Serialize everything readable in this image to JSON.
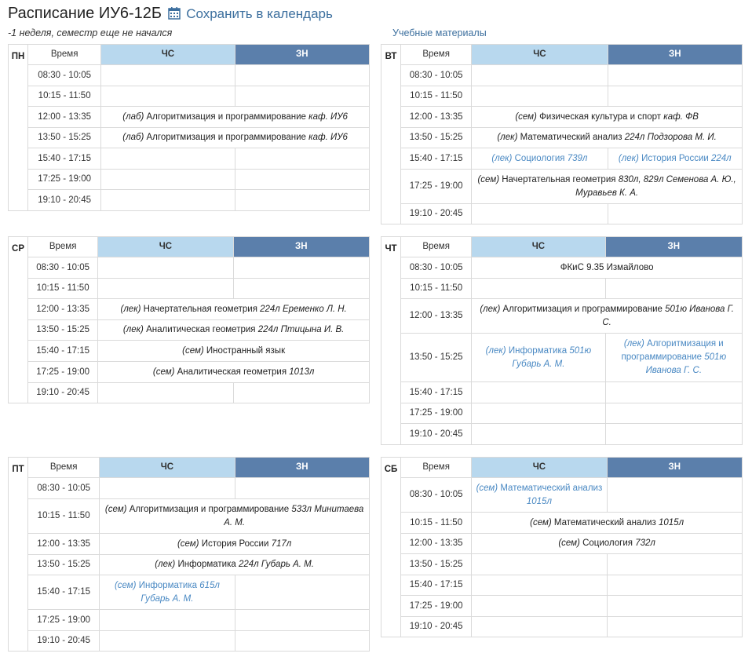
{
  "header": {
    "title": "Расписание ИУ6-12Б",
    "calendar_link": "Сохранить в календарь",
    "subtitle": "-1 неделя, семестр еще не начался",
    "materials_link": "Учебные материалы"
  },
  "colors": {
    "cs_header": "#b8d8ee",
    "zn_header": "#5b7fab",
    "link": "#3c6f9e",
    "alt_week_text": "#4a89c3"
  },
  "labels": {
    "time": "Время",
    "cs": "ЧС",
    "zn": "ЗН"
  },
  "days": [
    {
      "name": "ПН",
      "rows": [
        {
          "time": "08:30 - 10:05"
        },
        {
          "time": "10:15 - 11:50"
        },
        {
          "time": "12:00 - 13:35",
          "both": {
            "type": "(лаб)",
            "subject": "Алгоритмизация и программирование",
            "details": "каф. ИУ6"
          }
        },
        {
          "time": "13:50 - 15:25",
          "both": {
            "type": "(лаб)",
            "subject": "Алгоритмизация и программирование",
            "details": "каф. ИУ6"
          }
        },
        {
          "time": "15:40 - 17:15"
        },
        {
          "time": "17:25 - 19:00"
        },
        {
          "time": "19:10 - 20:45"
        }
      ]
    },
    {
      "name": "ВТ",
      "rows": [
        {
          "time": "08:30 - 10:05"
        },
        {
          "time": "10:15 - 11:50"
        },
        {
          "time": "12:00 - 13:35",
          "both": {
            "type": "(сем)",
            "subject": "Физическая культура и спорт",
            "details": "каф. ФВ"
          }
        },
        {
          "time": "13:50 - 15:25",
          "both": {
            "type": "(лек)",
            "subject": "Математический анализ",
            "details": "224л Подзорова М. И."
          }
        },
        {
          "time": "15:40 - 17:15",
          "cs": {
            "type": "(лек)",
            "subject": "Социология",
            "details": "739л"
          },
          "zn": {
            "type": "(лек)",
            "subject": "История России",
            "details": "224л"
          }
        },
        {
          "time": "17:25 - 19:00",
          "both": {
            "type": "(сем)",
            "subject": "Начертательная геометрия",
            "details": "830л, 829л Семенова А. Ю., Муравьев К. А."
          }
        },
        {
          "time": "19:10 - 20:45"
        }
      ]
    },
    {
      "name": "СР",
      "rows": [
        {
          "time": "08:30 - 10:05"
        },
        {
          "time": "10:15 - 11:50"
        },
        {
          "time": "12:00 - 13:35",
          "both": {
            "type": "(лек)",
            "subject": "Начертательная геометрия",
            "details": "224л Еременко Л. Н."
          }
        },
        {
          "time": "13:50 - 15:25",
          "both": {
            "type": "(лек)",
            "subject": "Аналитическая геометрия",
            "details": "224л Птицына И. В."
          }
        },
        {
          "time": "15:40 - 17:15",
          "both": {
            "type": "(сем)",
            "subject": "Иностранный язык",
            "details": ""
          }
        },
        {
          "time": "17:25 - 19:00",
          "both": {
            "type": "(сем)",
            "subject": "Аналитическая геометрия",
            "details": "1013л"
          }
        },
        {
          "time": "19:10 - 20:45"
        }
      ]
    },
    {
      "name": "ЧТ",
      "rows": [
        {
          "time": "08:30 - 10:05",
          "both": {
            "type": "",
            "subject": "ФКиС 9.35 Измайлово",
            "details": ""
          }
        },
        {
          "time": "10:15 - 11:50"
        },
        {
          "time": "12:00 - 13:35",
          "both": {
            "type": "(лек)",
            "subject": "Алгоритмизация и программирование",
            "details": "501ю Иванова Г. С."
          }
        },
        {
          "time": "13:50 - 15:25",
          "cs": {
            "type": "(лек)",
            "subject": "Информатика",
            "details": "501ю Губарь А. М."
          },
          "zn": {
            "type": "(лек)",
            "subject": "Алгоритмизация и программирование",
            "details": "501ю Иванова Г. С."
          }
        },
        {
          "time": "15:40 - 17:15"
        },
        {
          "time": "17:25 - 19:00"
        },
        {
          "time": "19:10 - 20:45"
        }
      ]
    },
    {
      "name": "ПТ",
      "rows": [
        {
          "time": "08:30 - 10:05"
        },
        {
          "time": "10:15 - 11:50",
          "both": {
            "type": "(сем)",
            "subject": "Алгоритмизация и программирование",
            "details": "533л Минитаева А. М."
          }
        },
        {
          "time": "12:00 - 13:35",
          "both": {
            "type": "(сем)",
            "subject": "История России",
            "details": "717л"
          }
        },
        {
          "time": "13:50 - 15:25",
          "both": {
            "type": "(лек)",
            "subject": "Информатика",
            "details": "224л Губарь А. М."
          }
        },
        {
          "time": "15:40 - 17:15",
          "cs": {
            "type": "(сем)",
            "subject": "Информатика",
            "details": "615л Губарь А. М."
          }
        },
        {
          "time": "17:25 - 19:00"
        },
        {
          "time": "19:10 - 20:45"
        }
      ]
    },
    {
      "name": "СБ",
      "rows": [
        {
          "time": "08:30 - 10:05",
          "cs": {
            "type": "(сем)",
            "subject": "Математический анализ",
            "details": "1015л"
          }
        },
        {
          "time": "10:15 - 11:50",
          "both": {
            "type": "(сем)",
            "subject": "Математический анализ",
            "details": "1015л"
          }
        },
        {
          "time": "12:00 - 13:35",
          "both": {
            "type": "(сем)",
            "subject": "Социология",
            "details": "732л"
          }
        },
        {
          "time": "13:50 - 15:25"
        },
        {
          "time": "15:40 - 17:15"
        },
        {
          "time": "17:25 - 19:00"
        },
        {
          "time": "19:10 - 20:45"
        }
      ]
    }
  ]
}
